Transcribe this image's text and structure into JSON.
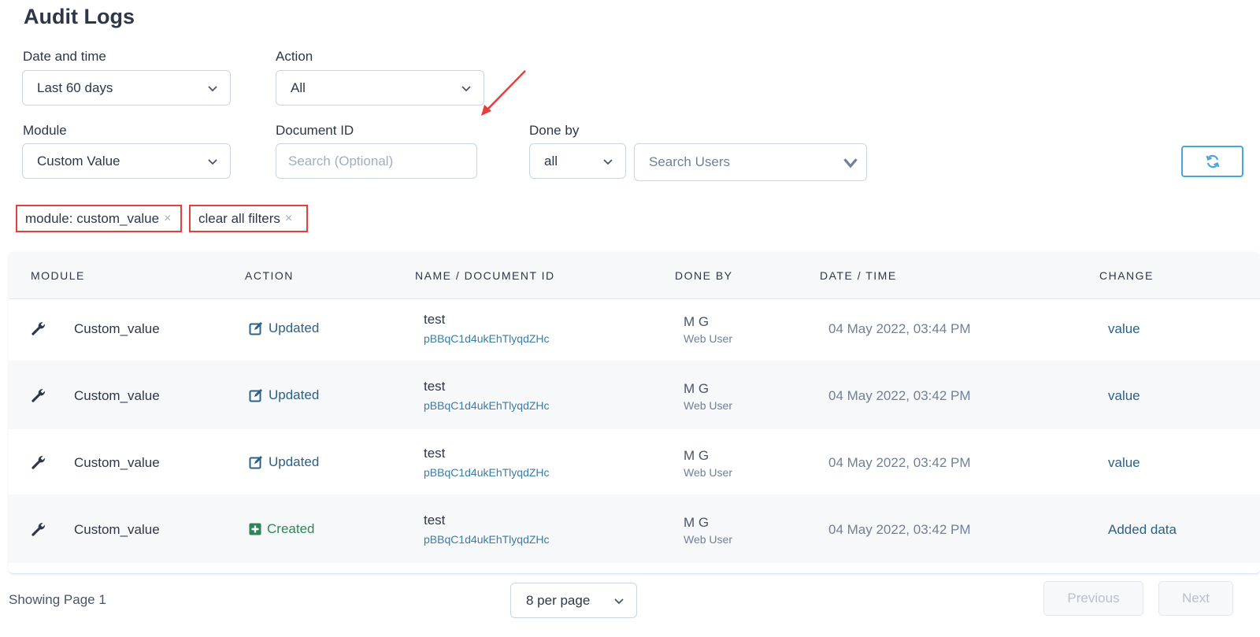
{
  "page": {
    "title": "Audit Logs"
  },
  "filters": {
    "date_label": "Date and time",
    "date_value": "Last 60 days",
    "action_label": "Action",
    "action_value": "All",
    "module_label": "Module",
    "module_value": "Custom Value",
    "docid_label": "Document ID",
    "docid_placeholder": "Search (Optional)",
    "doneby_label": "Done by",
    "doneby_value": "all",
    "users_placeholder": "Search Users"
  },
  "chips": [
    {
      "label": "module: custom_value",
      "close": "×"
    },
    {
      "label": "clear all filters",
      "close": "×"
    }
  ],
  "table": {
    "headers": [
      "MODULE",
      "ACTION",
      "NAME / DOCUMENT ID",
      "DONE BY",
      "DATE / TIME",
      "CHANGE"
    ],
    "rows": [
      {
        "module": "Custom_value",
        "action": "Updated",
        "name": "test",
        "doc_id": "pBBqC1d4ukEhTlyqdZHc",
        "by": "M G",
        "by_role": "Web User",
        "date": "04 May 2022, 03:44 PM",
        "change": "value"
      },
      {
        "module": "Custom_value",
        "action": "Updated",
        "name": "test",
        "doc_id": "pBBqC1d4ukEhTlyqdZHc",
        "by": "M G",
        "by_role": "Web User",
        "date": "04 May 2022, 03:42 PM",
        "change": "value"
      },
      {
        "module": "Custom_value",
        "action": "Updated",
        "name": "test",
        "doc_id": "pBBqC1d4ukEhTlyqdZHc",
        "by": "M G",
        "by_role": "Web User",
        "date": "04 May 2022, 03:42 PM",
        "change": "value"
      },
      {
        "module": "Custom_value",
        "action": "Created",
        "name": "test",
        "doc_id": "pBBqC1d4ukEhTlyqdZHc",
        "by": "M G",
        "by_role": "Web User",
        "date": "04 May 2022, 03:42 PM",
        "change": "Added data"
      }
    ]
  },
  "footer": {
    "showing": "Showing Page 1",
    "per_page": "8 per page",
    "previous": "Previous",
    "next": "Next"
  },
  "colors": {
    "annotation": "#e53e3e",
    "updated": "#2c6086",
    "created": "#2f855a",
    "refresh_border": "#4aa3df"
  }
}
